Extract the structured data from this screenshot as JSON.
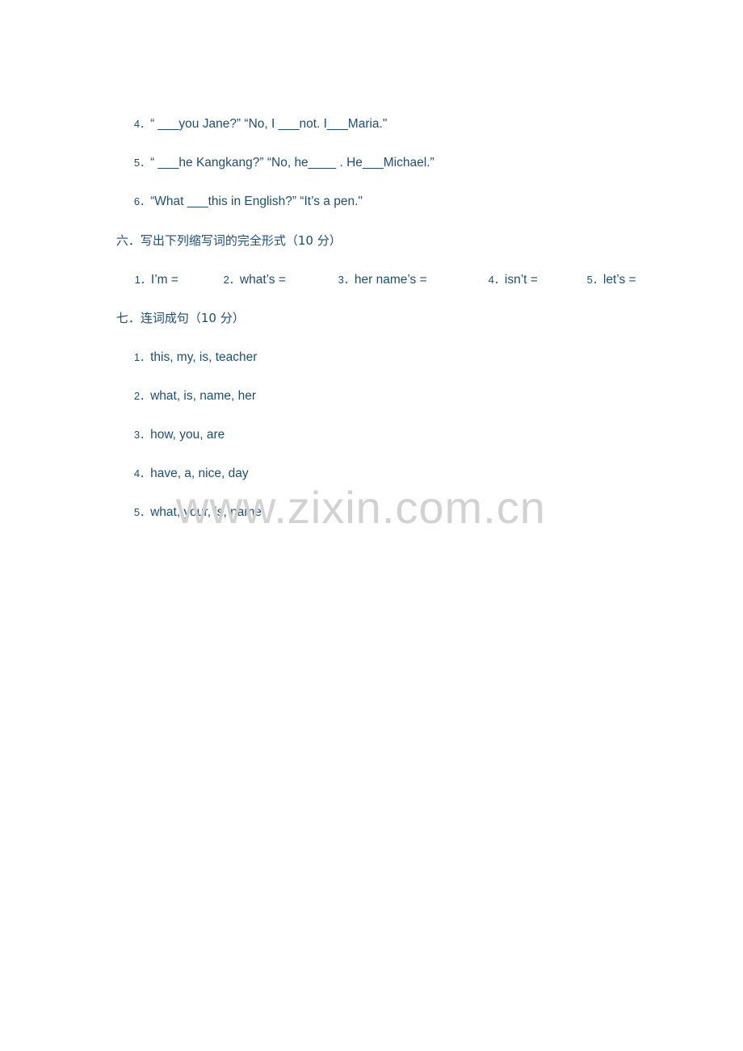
{
  "document": {
    "watermark": "www.zixin.com.cn",
    "exercise_items_top": [
      {
        "num": "4．",
        "text": "“ ___you Jane?” “No, I ___not. I___Maria.\""
      },
      {
        "num": "5．",
        "text": "“ ___he Kangkang?” “No, he____ . He___Michael.”"
      },
      {
        "num": "6．",
        "text": "“What ___this in English?” “It’s a pen.\""
      }
    ],
    "section_six": {
      "label": "六．",
      "title": "写出下列缩写词的完全形式",
      "score": "（10 分）",
      "items": [
        {
          "num": "1．",
          "text": "I’m ="
        },
        {
          "num": "2．",
          "text": "what’s ="
        },
        {
          "num": "3．",
          "text": "her name’s ="
        },
        {
          "num": "4．",
          "text": "isn’t ="
        },
        {
          "num": "5．",
          "text": "let’s ="
        }
      ]
    },
    "section_seven": {
      "label": "七．",
      "title": "连词成句",
      "score": "（10 分）",
      "items": [
        {
          "num": "1．",
          "text": "this, my, is, teacher"
        },
        {
          "num": "2．",
          "text": "what, is, name, her"
        },
        {
          "num": "3．",
          "text": "how, you, are"
        },
        {
          "num": "4．",
          "text": "have, a, nice, day"
        },
        {
          "num": "5．",
          "text": "what, your, is, name"
        }
      ]
    }
  }
}
